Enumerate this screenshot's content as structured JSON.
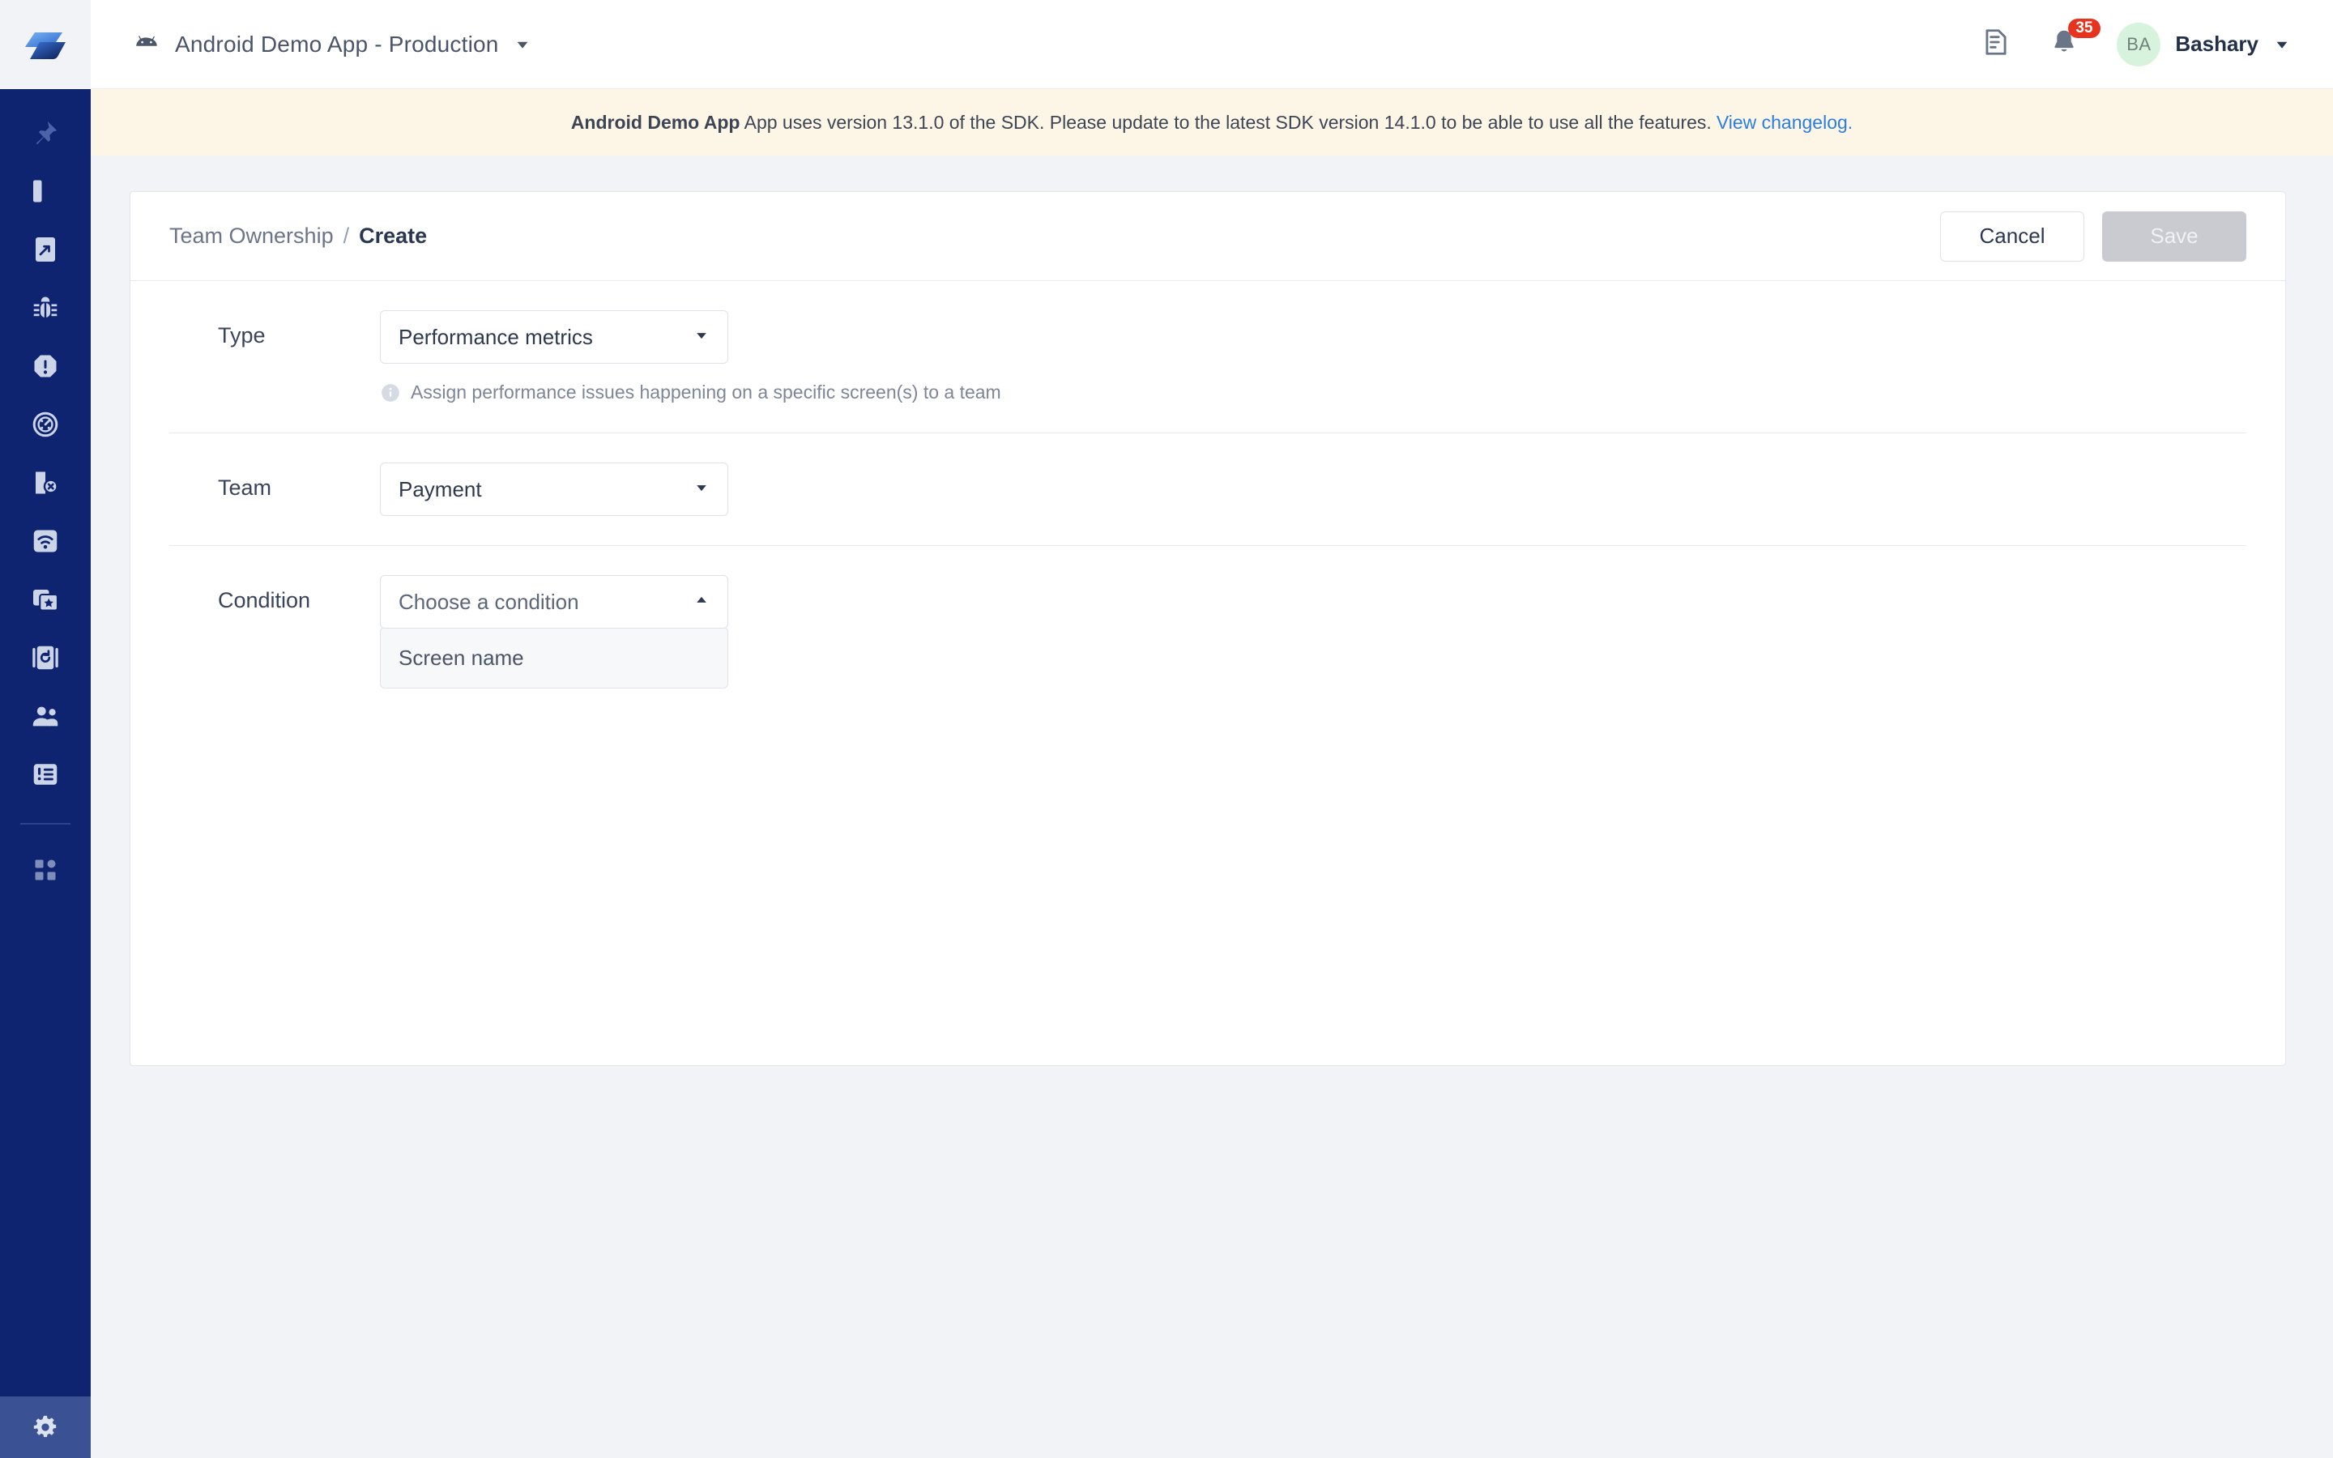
{
  "sidebar": {
    "logo": "instabug-logo",
    "items": [
      {
        "name": "pin",
        "icon": "pin-icon",
        "label": "Pin"
      },
      {
        "name": "dashboards",
        "icon": "dashboard-chart-icon",
        "label": "Dashboards"
      },
      {
        "name": "releases",
        "icon": "release-arrow-icon",
        "label": "Releases"
      },
      {
        "name": "bugs",
        "icon": "bug-icon",
        "label": "Bugs"
      },
      {
        "name": "crashes",
        "icon": "crash-alert-icon",
        "label": "Crashes"
      },
      {
        "name": "performance",
        "icon": "performance-gauge-icon",
        "label": "App Performance"
      },
      {
        "name": "errors",
        "icon": "screen-error-icon",
        "label": "Errors"
      },
      {
        "name": "network",
        "icon": "network-signal-icon",
        "label": "Network"
      },
      {
        "name": "surveys",
        "icon": "surveys-star-icon",
        "label": "Surveys"
      },
      {
        "name": "replays",
        "icon": "session-replay-icon",
        "label": "Session Replay"
      },
      {
        "name": "users",
        "icon": "users-group-icon",
        "label": "Users"
      },
      {
        "name": "feature-requests",
        "icon": "list-alert-icon",
        "label": "Feature Requests"
      },
      {
        "name": "apps-grid",
        "icon": "apps-grid-icon",
        "label": "Apps"
      }
    ],
    "footer": {
      "name": "settings",
      "icon": "gear-icon",
      "label": "Settings"
    }
  },
  "topbar": {
    "platform_icon": "android-icon",
    "app_name": "Android Demo App - Production",
    "app_switcher_caret": "chevron-down-icon",
    "docs_icon": "document-icon",
    "notifications_icon": "bell-icon",
    "notifications_count": "35",
    "avatar_initials": "BA",
    "user_name": "Bashary",
    "user_caret": "chevron-down-icon"
  },
  "banner": {
    "app_name": "Android Demo App",
    "text": " App uses version 13.1.0 of the SDK. Please update to the latest SDK version 14.1.0 to be able to use all the features.",
    "link": "View changelog."
  },
  "card": {
    "breadcrumb": {
      "parent": "Team Ownership",
      "separator": "/",
      "current": "Create"
    },
    "cancel_label": "Cancel",
    "save_label": "Save"
  },
  "form": {
    "type": {
      "label": "Type",
      "value": "Performance metrics",
      "hint_icon": "info-icon",
      "hint": "Assign performance issues happening on a specific screen(s) to a team"
    },
    "team": {
      "label": "Team",
      "value": "Payment"
    },
    "condition": {
      "label": "Condition",
      "placeholder": "Choose a condition",
      "open": true,
      "options": [
        "Screen name"
      ]
    }
  },
  "colors": {
    "sidebar_bg": "#0e2470",
    "sidebar_footer_bg": "#3a5294",
    "page_bg": "#f1f3f7",
    "banner_bg": "#fdf6e6",
    "link": "#2a7de1",
    "badge_red": "#e8341f",
    "avatar_bg": "#d7f3dd",
    "save_disabled_bg": "#c9cbd0"
  }
}
